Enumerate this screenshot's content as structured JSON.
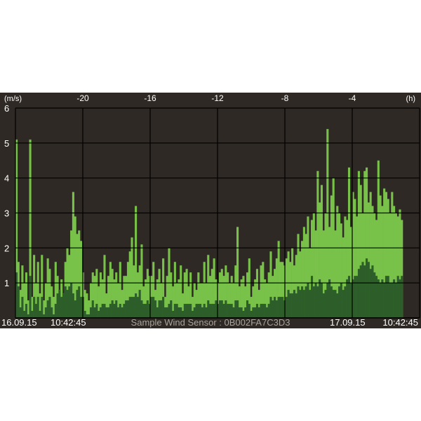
{
  "chart_data": {
    "type": "bar",
    "x_unit": "(h)",
    "y_unit": "(m/s)",
    "x_ticks": [
      "-20",
      "-16",
      "-12",
      "-8",
      "-4"
    ],
    "y_ticks": [
      "1",
      "2",
      "3",
      "4",
      "5",
      "6"
    ],
    "xlim": [
      -24,
      0
    ],
    "ylim": [
      0,
      6
    ],
    "x_range_covered": [
      -24,
      -1
    ],
    "grid": true,
    "series": [
      {
        "role": "gust",
        "color": "#79c24a",
        "values": [
          5.1,
          1.6,
          0.8,
          1.5,
          1.0,
          1.3,
          0.5,
          5.1,
          0.6,
          1.8,
          1.0,
          1.6,
          0.7,
          1.8,
          0.5,
          1.0,
          1.7,
          1.4,
          0.9,
          0.6,
          1.6,
          1.2,
          0.8,
          1.1,
          0.7,
          1.6,
          2.0,
          1.8,
          2.5,
          3.6,
          2.9,
          2.4,
          2.5,
          2.2,
          1.3,
          0.8,
          0.7,
          0.5,
          1.0,
          1.3,
          1.2,
          1.4,
          0.9,
          1.3,
          1.1,
          1.8,
          0.7,
          1.2,
          1.6,
          1.4,
          1.1,
          1.3,
          1.0,
          1.6,
          0.8,
          1.2,
          1.2,
          1.6,
          1.9,
          2.3,
          1.5,
          3.2,
          1.3,
          1.5,
          2.1,
          0.9,
          1.1,
          1.4,
          1.2,
          1.2,
          1.6,
          0.8,
          1.1,
          1.4,
          1.0,
          1.7,
          0.6,
          1.2,
          2.0,
          1.3,
          0.9,
          1.6,
          1.0,
          1.1,
          1.5,
          0.7,
          1.3,
          1.4,
          0.9,
          1.3,
          0.6,
          1.0,
          0.8,
          1.3,
          1.0,
          1.0,
          1.6,
          1.0,
          1.8,
          1.2,
          1.4,
          1.7,
          1.1,
          1.0,
          1.3,
          1.4,
          1.2,
          1.5,
          1.3,
          1.0,
          1.2,
          1.0,
          1.5,
          2.6,
          0.9,
          1.1,
          1.2,
          0.9,
          1.3,
          1.7,
          0.6,
          0.9,
          1.1,
          1.4,
          0.8,
          1.5,
          1.6,
          1.1,
          1.0,
          1.3,
          1.9,
          1.2,
          1.4,
          1.7,
          2.2,
          1.6,
          1.6,
          1.5,
          1.7,
          1.9,
          1.6,
          2.0,
          1.5,
          1.8,
          2.4,
          1.9,
          2.2,
          2.6,
          2.4,
          2.9,
          2.0,
          2.8,
          3.0,
          2.5,
          4.2,
          3.3,
          3.8,
          2.5,
          3.0,
          5.4,
          2.6,
          3.5,
          4.0,
          2.5,
          3.2,
          3.0,
          2.7,
          2.3,
          2.9,
          2.8,
          4.3,
          2.6,
          3.6,
          3.4,
          2.9,
          4.2,
          3.8,
          3.0,
          4.2,
          4.3,
          3.3,
          3.6,
          3.2,
          3.0,
          2.8,
          4.5,
          3.5,
          3.2,
          3.7,
          3.6,
          3.4,
          3.0,
          3.6,
          3.2,
          3.0,
          2.9,
          3.1,
          2.8
        ]
      },
      {
        "role": "average",
        "color": "#2d5e2a",
        "values": [
          1.3,
          0.9,
          0.3,
          0.6,
          0.2,
          0.4,
          0.1,
          1.2,
          0.2,
          0.6,
          0.4,
          0.6,
          0.2,
          0.6,
          0.1,
          0.3,
          0.5,
          0.6,
          0.3,
          0.1,
          0.4,
          0.7,
          0.8,
          0.6,
          0.7,
          0.9,
          0.8,
          0.9,
          1.0,
          0.7,
          0.5,
          0.8,
          0.9,
          0.6,
          0.6,
          0.2,
          0.1,
          0.1,
          0.3,
          0.5,
          0.3,
          0.4,
          0.2,
          0.3,
          0.4,
          0.4,
          0.3,
          0.3,
          0.4,
          0.5,
          0.4,
          0.5,
          0.3,
          0.4,
          0.3,
          0.4,
          0.5,
          0.5,
          0.6,
          0.6,
          0.6,
          0.7,
          0.6,
          0.8,
          0.5,
          0.4,
          0.4,
          0.5,
          0.4,
          0.6,
          0.6,
          0.5,
          0.3,
          0.5,
          0.5,
          0.6,
          0.3,
          0.3,
          0.4,
          0.5,
          0.2,
          0.4,
          0.4,
          0.3,
          0.3,
          0.2,
          0.4,
          0.4,
          0.4,
          0.4,
          0.2,
          0.3,
          0.4,
          0.4,
          0.4,
          0.3,
          0.4,
          0.3,
          0.5,
          0.4,
          0.4,
          0.4,
          0.5,
          0.4,
          0.5,
          0.5,
          0.4,
          0.5,
          0.4,
          0.4,
          0.4,
          0.3,
          0.5,
          0.5,
          0.3,
          0.3,
          0.2,
          0.3,
          0.5,
          0.4,
          0.2,
          0.3,
          0.3,
          0.4,
          0.3,
          0.4,
          0.4,
          0.4,
          0.3,
          0.4,
          0.6,
          0.5,
          0.6,
          0.5,
          0.6,
          0.6,
          0.6,
          0.5,
          0.6,
          0.8,
          0.7,
          0.7,
          0.8,
          0.7,
          0.9,
          0.8,
          0.9,
          0.8,
          0.9,
          1.0,
          0.8,
          1.2,
          0.9,
          1.0,
          0.9,
          1.1,
          1.0,
          0.7,
          0.8,
          1.0,
          1.1,
          0.9,
          0.8,
          0.8,
          0.7,
          0.9,
          1.0,
          0.8,
          0.9,
          1.1,
          1.2,
          1.0,
          1.1,
          1.2,
          1.2,
          1.4,
          1.5,
          1.6,
          1.5,
          1.7,
          1.6,
          1.4,
          1.5,
          1.3,
          1.2,
          1.1,
          1.0,
          1.1,
          1.0,
          1.2,
          1.2,
          1.0,
          1.0,
          1.1,
          1.0,
          1.2,
          1.1,
          1.2
        ]
      }
    ]
  },
  "footer": {
    "start_date": "16.09.15",
    "start_time": "10:42:45",
    "sensor_label": "Sample Wind Sensor : 0B002FA7C3D3",
    "end_date": "17.09.15",
    "end_time": "10:42:45"
  },
  "colors": {
    "background": "#2e2924",
    "grid": "#000000",
    "gust": "#79c24a",
    "average": "#2d5e2a",
    "label": "#ffffff",
    "sensor_label": "#a9a39c"
  }
}
